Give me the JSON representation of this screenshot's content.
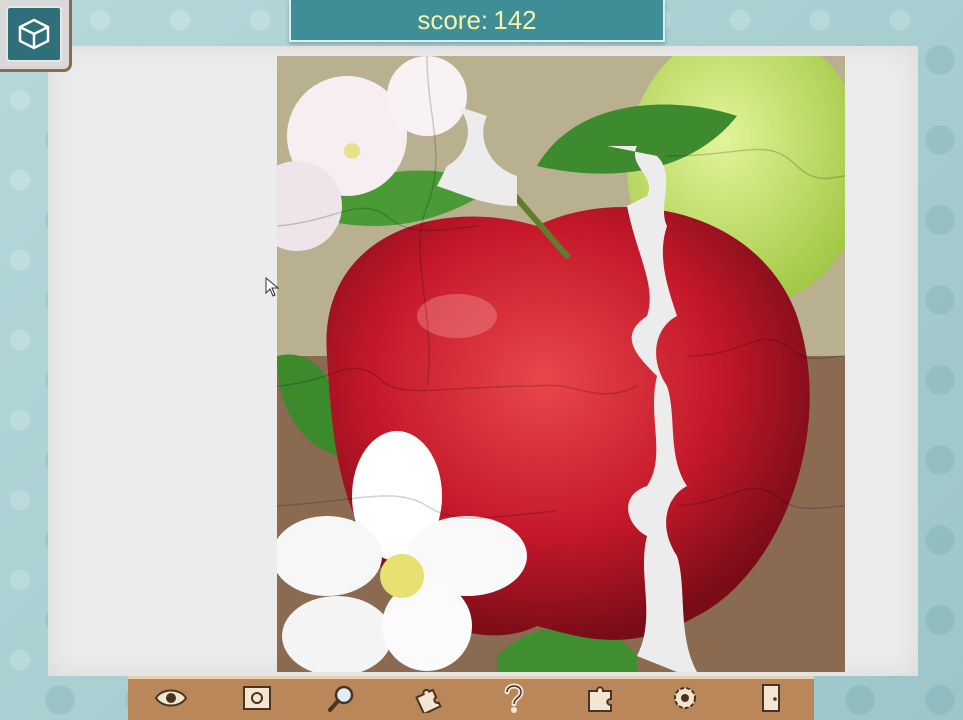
{
  "score": {
    "label": "score:",
    "value": "142"
  },
  "menu": {
    "icon": "cube-menu-icon"
  },
  "toolbar": {
    "tools": [
      {
        "name": "preview-eye",
        "icon": "eye-icon"
      },
      {
        "name": "background",
        "icon": "picture-icon"
      },
      {
        "name": "magnifier",
        "icon": "magnifier-icon"
      },
      {
        "name": "sort-edges",
        "icon": "puzzle-pieces-icon"
      },
      {
        "name": "help",
        "icon": "question-icon"
      },
      {
        "name": "hint-piece",
        "icon": "puzzle-piece-icon"
      },
      {
        "name": "settings",
        "icon": "gear-icon"
      },
      {
        "name": "exit",
        "icon": "door-exit-icon"
      }
    ]
  },
  "colors": {
    "banner": "#3f8d97",
    "score_text": "#f4f3a8",
    "toolbar": "#b9875a",
    "board": "#ececec"
  }
}
